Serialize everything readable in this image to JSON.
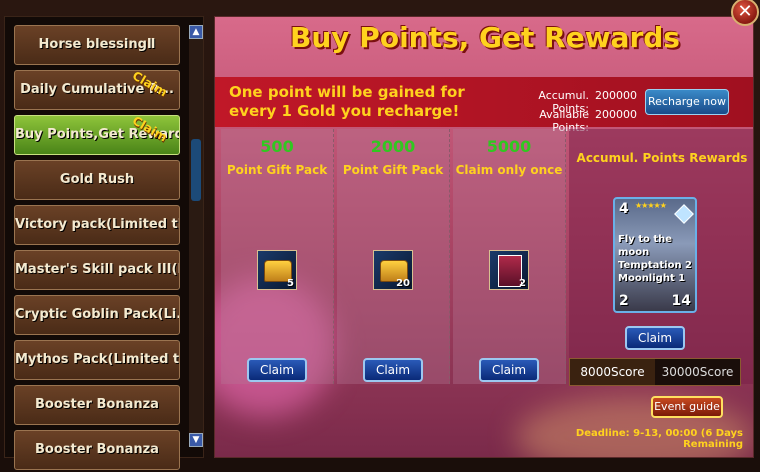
{
  "sidebar": {
    "items": [
      {
        "label": "Horse blessingⅡ",
        "claim": "",
        "active": false
      },
      {
        "label": "Daily Cumulative R...",
        "claim": "Claim",
        "active": false
      },
      {
        "label": "Buy Points,Get Rewards",
        "claim": "Claim",
        "active": true
      },
      {
        "label": "Gold Rush",
        "claim": "",
        "active": false
      },
      {
        "label": "Victory pack(Limited ti...",
        "claim": "",
        "active": false
      },
      {
        "label": "Master's Skill pack III(L...",
        "claim": "",
        "active": false
      },
      {
        "label": "Cryptic Goblin Pack(Li...",
        "claim": "",
        "active": false
      },
      {
        "label": "Mythos Pack(Limited ti...",
        "claim": "",
        "active": false
      },
      {
        "label": "Booster Bonanza",
        "claim": "",
        "active": false
      },
      {
        "label": "Booster Bonanza",
        "claim": "",
        "active": false
      }
    ],
    "scroll_up": "▲",
    "scroll_down": "▼"
  },
  "main": {
    "title": "Buy Points, Get Rewards",
    "info": "One point will be gained for every 1 Gold you recharge!",
    "accum_label": "Accumul. Points:",
    "accum_value": "200000",
    "avail_label": "Available Points:",
    "avail_value": "200000",
    "recharge_label": "Recharge now",
    "packs": [
      {
        "score": "500",
        "name": "Point Gift Pack",
        "item": "chest",
        "qty": "5",
        "claim": "Claim"
      },
      {
        "score": "2000",
        "name": "Point Gift Pack",
        "item": "chest",
        "qty": "20",
        "claim": "Claim"
      },
      {
        "score": "5000",
        "name": "Claim only once",
        "item": "card",
        "qty": "2",
        "claim": "Claim"
      }
    ],
    "accum_rewards_title": "Accumul. Points Rewards",
    "card": {
      "cost": "4",
      "stars": "★★★★★",
      "name": "Fly to the moon Temptation 2 Moonlight 1",
      "attack": "2",
      "hp": "14"
    },
    "card_claim": "Claim",
    "score_tabs": [
      "8000Score",
      "30000Score"
    ],
    "event_guide": "Event guide",
    "deadline": "Deadline: 9-13, 00:00 (6 Days Remaining"
  },
  "close_label": "✕",
  "colors": {
    "accent_gold": "#ffd21e",
    "score_green": "#30c820",
    "claim_blue": "#2a5ab8"
  }
}
